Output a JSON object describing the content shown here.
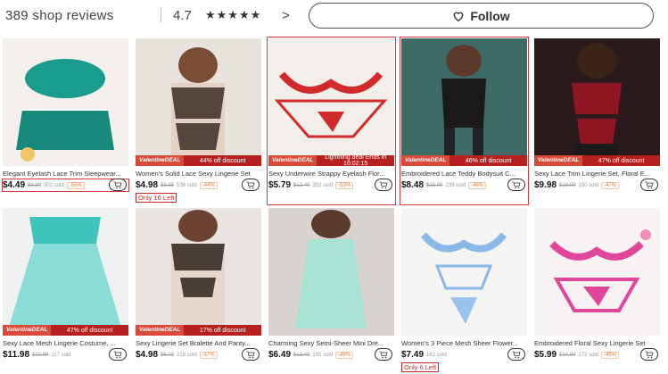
{
  "header": {
    "reviews": "389 shop reviews",
    "rating": "4.7",
    "stars": "★★★★★",
    "chevron": ">",
    "follow_label": "Follow"
  },
  "products": [
    {
      "title": "Elegant Eyelash Lace Trim Sleepwear...",
      "price": "$4.49",
      "old_price": "$9.99",
      "sold": "901 sold",
      "discount": "-55%",
      "deal_label": "",
      "deal_tag": "",
      "stock": ""
    },
    {
      "title": "Women's Solid Lace Sexy Lingerie Set",
      "price": "$4.98",
      "old_price": "$8.95",
      "sold": "536 sold",
      "discount": "-44%",
      "deal_label": "44% off discount",
      "deal_tag": "ValentineDEAL",
      "stock": "Only 16 Left"
    },
    {
      "title": "Sexy Underwire Strappy Eyelash Flor...",
      "price": "$5.79",
      "old_price": "$12.49",
      "sold": "352 sold",
      "discount": "-53%",
      "deal_label": "Lightning deal",
      "deal_sub": "Ends in 16:02:15",
      "deal_tag": "ValentineDEAL",
      "stock": ""
    },
    {
      "title": "Embroidered Lace Teddy Bodysuit C...",
      "price": "$8.48",
      "old_price": "$15.99",
      "sold": "239 sold",
      "discount": "-46%",
      "deal_label": "46% off discount",
      "deal_tag": "ValentineDEAL",
      "stock": ""
    },
    {
      "title": "Sexy Lace Trim Lingerie Set, Floral E...",
      "price": "$9.98",
      "old_price": "$18.99",
      "sold": "150 sold",
      "discount": "-47%",
      "deal_label": "47% off discount",
      "deal_tag": "ValentineDEAL",
      "stock": ""
    },
    {
      "title": "Sexy Lace Mesh Lingerie Costume, ...",
      "price": "$11.98",
      "old_price": "$22.99",
      "sold": "117 sold",
      "discount": "",
      "deal_label": "47% off discount",
      "deal_tag": "ValentineDEAL",
      "stock": ""
    },
    {
      "title": "Sexy Lingerie Set Bralette And Panty...",
      "price": "$4.98",
      "old_price": "$6.00",
      "sold": "218 sold",
      "discount": "-17%",
      "deal_label": "17% off discount",
      "deal_tag": "ValentineDEAL",
      "stock": ""
    },
    {
      "title": "Charming Sexy Semi-Sheer Mini Dre...",
      "price": "$6.49",
      "old_price": "$12.49",
      "sold": "195 sold",
      "discount": "-48%",
      "deal_label": "",
      "deal_tag": "",
      "stock": ""
    },
    {
      "title": "Women's 3 Piece Mesh Sheer Flower...",
      "price": "$7.49",
      "old_price": "",
      "sold": "162 sold",
      "discount": "",
      "deal_label": "",
      "deal_tag": "",
      "stock": "Only 6 Left"
    },
    {
      "title": "Embroidered Floral Sexy Lingerie Set",
      "price": "$5.99",
      "old_price": "$10.99",
      "sold": "172 sold",
      "discount": "-45%",
      "deal_label": "",
      "deal_tag": "",
      "stock": ""
    }
  ]
}
